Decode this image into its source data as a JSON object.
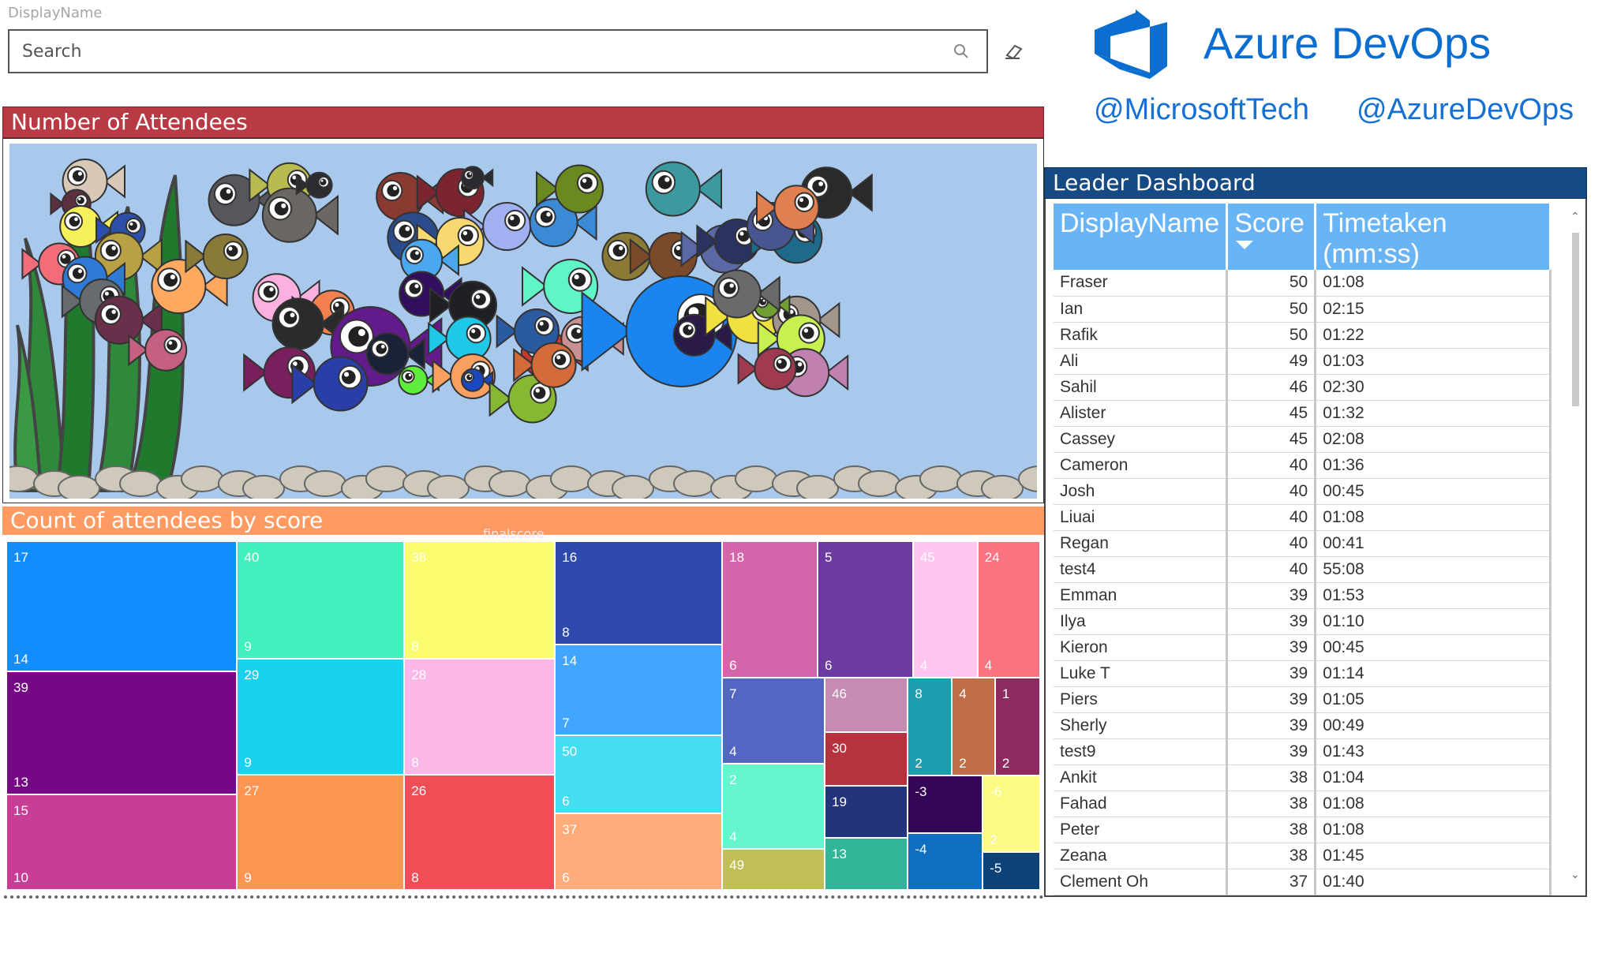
{
  "slicer": {
    "title": "DisplayName",
    "placeholder": "Search"
  },
  "logo": {
    "text": "Azure DevOps",
    "color": "#0a6ed1"
  },
  "handles": [
    "@MicrosoftTech",
    "@AzureDevOps"
  ],
  "attendees_panel": {
    "title": "Number of Attendees",
    "header_color": "#b83a45"
  },
  "treemap_panel": {
    "title": "Count of attendees by score",
    "faint_label": "finalscore",
    "header_color": "#ff9b62"
  },
  "chart_data": {
    "type": "treemap",
    "tiles": [
      {
        "score": "17",
        "count": "14",
        "color": "#118dff"
      },
      {
        "score": "39",
        "count": "13",
        "color": "#750985"
      },
      {
        "score": "15",
        "count": "10",
        "color": "#c83d95"
      },
      {
        "score": "40",
        "count": "9",
        "color": "#41f1bd"
      },
      {
        "score": "29",
        "count": "9",
        "color": "#1ad1ef"
      },
      {
        "score": "27",
        "count": "9",
        "color": "#ff9552"
      },
      {
        "score": "38",
        "count": "8",
        "color": "#fbfb6e"
      },
      {
        "score": "28",
        "count": "8",
        "color": "#fdb6e8"
      },
      {
        "score": "26",
        "count": "8",
        "color": "#f04e57"
      },
      {
        "score": "16",
        "count": "8",
        "color": "#2f4aad"
      },
      {
        "score": "14",
        "count": "7",
        "color": "#41a6ff"
      },
      {
        "score": "50",
        "count": "6",
        "color": "#44def0"
      },
      {
        "score": "37",
        "count": "6",
        "color": "#ffab7b"
      },
      {
        "score": "18",
        "count": "6",
        "color": "#d465ab"
      },
      {
        "score": "5",
        "count": "6",
        "color": "#6b3b9f"
      },
      {
        "score": "45",
        "count": "4",
        "color": "#ffc6ef"
      },
      {
        "score": "24",
        "count": "4",
        "color": "#f97380"
      },
      {
        "score": "7",
        "count": "4",
        "color": "#5367c2"
      },
      {
        "score": "2",
        "count": "4",
        "color": "#65f6ce"
      },
      {
        "score": "49",
        "count": "",
        "color": "#bfbf55"
      },
      {
        "score": "46",
        "count": "",
        "color": "#c58bb3"
      },
      {
        "score": "30",
        "count": "",
        "color": "#b6323f"
      },
      {
        "score": "19",
        "count": "",
        "color": "#24347c"
      },
      {
        "score": "13",
        "count": "",
        "color": "#31b69a"
      },
      {
        "score": "8",
        "count": "2",
        "color": "#1b9faf"
      },
      {
        "score": "4",
        "count": "2",
        "color": "#bf6e48"
      },
      {
        "score": "1",
        "count": "2",
        "color": "#8e2a60"
      },
      {
        "score": "-3",
        "count": "",
        "color": "#340656"
      },
      {
        "score": "-4",
        "count": "",
        "color": "#0e6ec1"
      },
      {
        "score": "-6",
        "count": "2",
        "color": "#fbfb83"
      },
      {
        "score": "-5",
        "count": "",
        "color": "#0c4277"
      }
    ]
  },
  "leader": {
    "title": "Leader Dashboard",
    "columns": [
      "DisplayName",
      "Score",
      "Timetaken (mm:ss)"
    ],
    "rows": [
      [
        "Fraser",
        "50",
        "01:08"
      ],
      [
        "Ian",
        "50",
        "02:15"
      ],
      [
        "Rafik",
        "50",
        "01:22"
      ],
      [
        "Ali",
        "49",
        "01:03"
      ],
      [
        "Sahil",
        "46",
        "02:30"
      ],
      [
        "Alister",
        "45",
        "01:32"
      ],
      [
        "Cassey",
        "45",
        "02:08"
      ],
      [
        "Cameron",
        "40",
        "01:36"
      ],
      [
        "Josh",
        "40",
        "00:45"
      ],
      [
        "Liuai",
        "40",
        "01:08"
      ],
      [
        "Regan",
        "40",
        "00:41"
      ],
      [
        "test4",
        "40",
        "55:08"
      ],
      [
        "Emman",
        "39",
        "01:53"
      ],
      [
        "Ilya",
        "39",
        "01:10"
      ],
      [
        "Kieron",
        "39",
        "00:45"
      ],
      [
        "Luke T",
        "39",
        "01:14"
      ],
      [
        "Piers",
        "39",
        "01:05"
      ],
      [
        "Sherly",
        "39",
        "00:49"
      ],
      [
        "test9",
        "39",
        "01:43"
      ],
      [
        "Ankit",
        "38",
        "01:04"
      ],
      [
        "Fahad",
        "38",
        "01:08"
      ],
      [
        "Peter",
        "38",
        "01:08"
      ],
      [
        "Zeana",
        "38",
        "01:45"
      ],
      [
        "Clement Oh",
        "37",
        "01:40"
      ]
    ]
  },
  "fish": [
    {
      "color": "#d8c8b8"
    },
    {
      "color": "#5d3040"
    },
    {
      "color": "#f5ef5a"
    },
    {
      "color": "#2e4fa8"
    },
    {
      "color": "#b8a045"
    },
    {
      "color": "#f26c7a"
    },
    {
      "color": "#2e7ad6"
    },
    {
      "color": "#666b70"
    },
    {
      "color": "#6a2f4a"
    },
    {
      "color": "#c46080"
    },
    {
      "color": "#ffa860"
    },
    {
      "color": "#8a7a3a"
    },
    {
      "color": "#56575c"
    },
    {
      "color": "#b9bb50"
    },
    {
      "color": "#6b6863"
    },
    {
      "color": "#2b2b30"
    },
    {
      "color": "#8a3a30"
    },
    {
      "color": "#7a2530"
    },
    {
      "color": "#2a2b30"
    },
    {
      "color": "#a0b0f0"
    },
    {
      "color": "#3b8ad6"
    },
    {
      "color": "#6a8a20"
    },
    {
      "color": "#2a4c8a"
    },
    {
      "color": "#f8d870"
    },
    {
      "color": "#4aa8f0"
    },
    {
      "color": "#60f5c8"
    },
    {
      "color": "#320f5e"
    },
    {
      "color": "#1f2024"
    },
    {
      "color": "#fcb0e0"
    },
    {
      "color": "#f28050"
    },
    {
      "color": "#2a2b2d"
    },
    {
      "color": "#7a1f5e"
    },
    {
      "color": "#631a8a"
    },
    {
      "color": "#2a3ea8"
    },
    {
      "color": "#1a223a"
    },
    {
      "color": "#20c8e8"
    },
    {
      "color": "#5eed3a"
    },
    {
      "color": "#f8a060"
    },
    {
      "color": "#1a48c0"
    },
    {
      "color": "#86b832"
    },
    {
      "color": "#c0382f"
    },
    {
      "color": "#2a5aa0"
    },
    {
      "color": "#c89090"
    },
    {
      "color": "#d26a3a"
    },
    {
      "color": "#8a7a35"
    },
    {
      "color": "#7a4a2a"
    },
    {
      "color": "#3a9aa0"
    },
    {
      "color": "#5a68a8"
    },
    {
      "color": "#55585a"
    },
    {
      "color": "#1a85f0"
    },
    {
      "color": "#2a1a48"
    },
    {
      "color": "#f0e040"
    },
    {
      "color": "#a2968a"
    },
    {
      "color": "#c8f050"
    },
    {
      "color": "#c080b0"
    },
    {
      "color": "#2a3260"
    },
    {
      "color": "#2a2a2d"
    },
    {
      "color": "#1e6a8a"
    },
    {
      "color": "#485590"
    },
    {
      "color": "#e08050"
    },
    {
      "color": "#70a030"
    },
    {
      "color": "#a03a50"
    },
    {
      "color": "#6a6a6a"
    }
  ]
}
